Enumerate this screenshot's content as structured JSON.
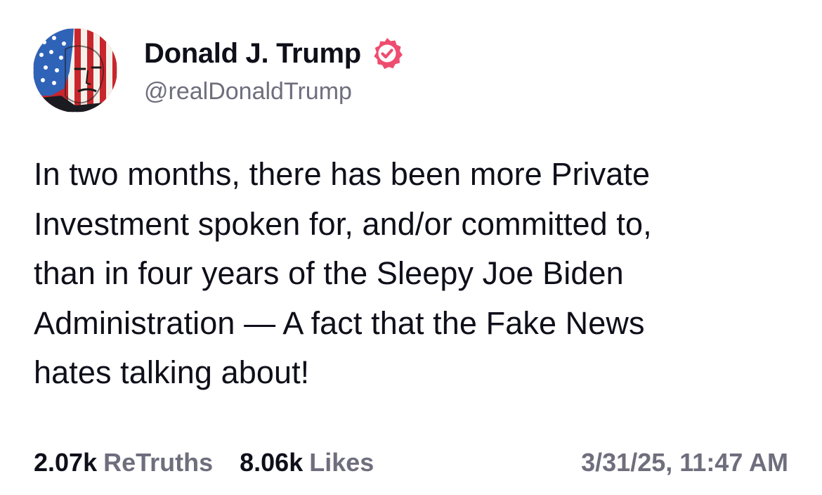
{
  "author": {
    "display_name": "Donald J. Trump",
    "handle": "@realDonaldTrump",
    "verified_badge_icon": "verified-check-icon",
    "badge_color": "#ee4d6f"
  },
  "post": {
    "lines": [
      "In two months, there has been more Private",
      "Investment spoken for, and/or committed to,",
      "than in four years of the Sleepy Joe Biden",
      "Administration — A fact that the Fake News",
      "hates talking about!"
    ]
  },
  "stats": {
    "retruths_count": "2.07k",
    "retruths_label": "ReTruths",
    "likes_count": "8.06k",
    "likes_label": "Likes"
  },
  "timestamp": "3/31/25, 11:47 AM",
  "colors": {
    "text_primary": "#0f0f1a",
    "text_secondary": "#6f6e7d",
    "background": "#ffffff"
  }
}
